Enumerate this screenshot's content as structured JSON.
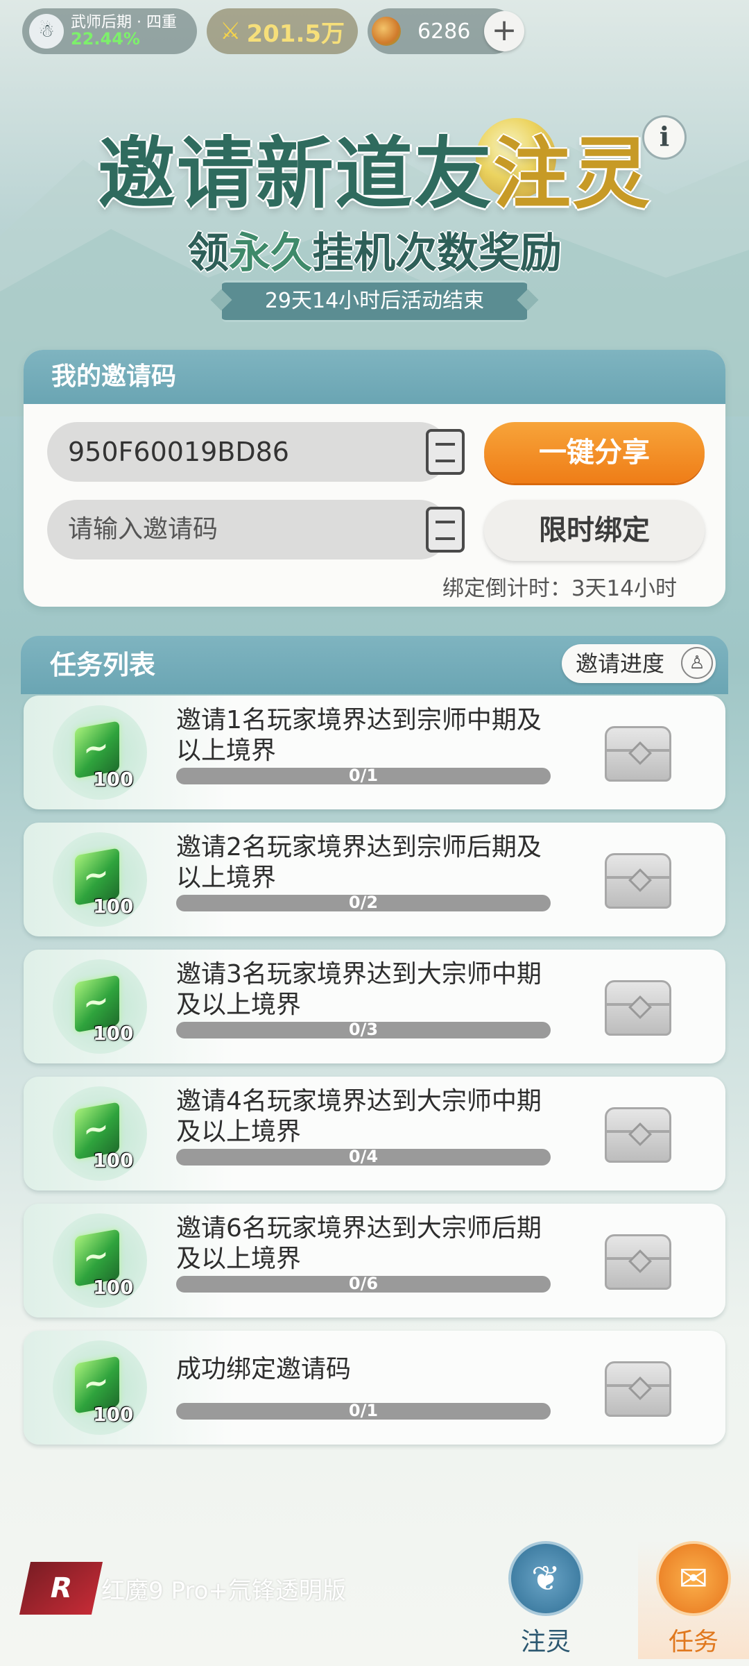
{
  "header": {
    "realm_name": "武师后期 · 四重",
    "realm_percent": "22.44%",
    "power_value": "201.5万",
    "jade_value": "6286",
    "plus_label": "+"
  },
  "banner": {
    "title_part1": "邀请新道友",
    "title_part2": "注灵",
    "subtitle_pre": "领",
    "subtitle_em": "永久",
    "subtitle_post": "挂机次数奖励",
    "timer": "29天14小时后活动结束",
    "info_label": "i"
  },
  "invite": {
    "header": "我的邀请码",
    "my_code": "950F60019BD86",
    "share_label": "一键分享",
    "input_placeholder": "请输入邀请码",
    "bind_label": "限时绑定",
    "countdown": "绑定倒计时：3天14小时"
  },
  "tasks": {
    "header": "任务列表",
    "progress_button": "邀请进度",
    "items": [
      {
        "desc": "邀请1名玩家境界达到宗师中期及以上境界",
        "reward": "100",
        "progress": "0/1",
        "fraction": 0
      },
      {
        "desc": "邀请2名玩家境界达到宗师后期及以上境界",
        "reward": "100",
        "progress": "0/2",
        "fraction": 0
      },
      {
        "desc": "邀请3名玩家境界达到大宗师中期及以上境界",
        "reward": "100",
        "progress": "0/3",
        "fraction": 0
      },
      {
        "desc": "邀请4名玩家境界达到大宗师中期及以上境界",
        "reward": "100",
        "progress": "0/4",
        "fraction": 0
      },
      {
        "desc": "邀请6名玩家境界达到大宗师后期及以上境界",
        "reward": "100",
        "progress": "0/6",
        "fraction": 0
      },
      {
        "desc": "成功绑定邀请码",
        "reward": "100",
        "progress": "0/1",
        "fraction": 0
      }
    ]
  },
  "watermark": {
    "logo": "R",
    "text": "红魔9 Pro+氘锋透明版"
  },
  "nav": {
    "inject_label": "注灵",
    "task_label": "任务"
  },
  "colors": {
    "accent_orange": "#ef7d17",
    "panel_header": "#6aa5b3",
    "title_green": "#2f6b5e"
  }
}
